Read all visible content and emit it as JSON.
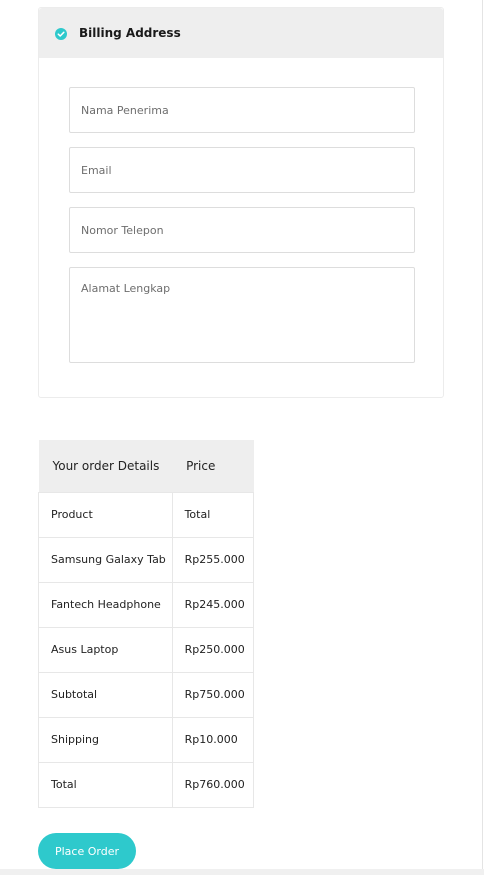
{
  "billing": {
    "title": "Billing Address",
    "fields": {
      "name_placeholder": "Nama Penerima",
      "email_placeholder": "Email",
      "phone_placeholder": "Nomor Telepon",
      "address_placeholder": "Alamat Lengkap"
    }
  },
  "order": {
    "header_item": "Your order Details",
    "header_price": "Price",
    "rows": [
      {
        "item": "Product",
        "price": "Total"
      },
      {
        "item": "Samsung Galaxy Tab",
        "price": "Rp255.000"
      },
      {
        "item": "Fantech Headphone",
        "price": "Rp245.000"
      },
      {
        "item": "Asus Laptop",
        "price": "Rp250.000"
      },
      {
        "item": "Subtotal",
        "price": "Rp750.000"
      },
      {
        "item": "Shipping",
        "price": "Rp10.000"
      },
      {
        "item": "Total",
        "price": "Rp760.000"
      }
    ]
  },
  "place_order_label": "Place Order",
  "colors": {
    "accent": "#2ec9cc",
    "header_bg": "#eeeeee",
    "border": "#e7e7e7"
  },
  "icons": {
    "billing_header": "check-circle-icon"
  }
}
